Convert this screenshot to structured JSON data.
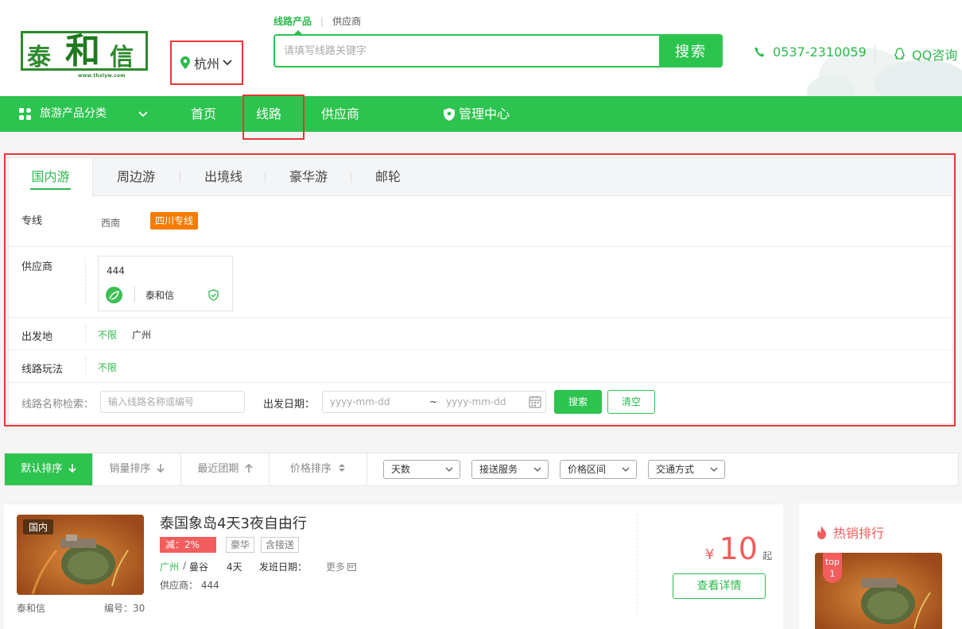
{
  "header": {
    "logo_text": "泰和信",
    "logo_url": "www.thxlyw.com",
    "city": "杭州",
    "search_tabs": [
      "线路产品",
      "供应商"
    ],
    "search_placeholder": "请填写线路关键字",
    "search_button": "搜索",
    "phone": "0537-2310059",
    "qq": "QQ咨询"
  },
  "nav": {
    "category": "旅游产品分类",
    "items": [
      "首页",
      "线路",
      "供应商",
      "管理中心"
    ]
  },
  "filter": {
    "tabs": [
      "国内游",
      "周边游",
      "出境线",
      "豪华游",
      "邮轮"
    ],
    "active_tab": "国内游",
    "line_label": "专线",
    "line_options": [
      "西南",
      "四川专线"
    ],
    "supplier_label": "供应商",
    "supplier_card": {
      "number": "444",
      "name": "泰和信"
    },
    "departure_label": "出发地",
    "departure_options": [
      "不限",
      "广州"
    ],
    "play_label": "线路玩法",
    "play_options": [
      "不限"
    ],
    "name_search_label": "线路名称检索：",
    "name_search_placeholder": "输入线路名称或编号",
    "date_label": "出发日期：",
    "date_placeholder": "yyyy-mm-dd",
    "date_sep": "~",
    "search_button": "搜索",
    "clear_button": "清空"
  },
  "sort": {
    "items": [
      "默认排序",
      "销量排序",
      "最近团期",
      "价格排序"
    ],
    "dropdowns": [
      "天数",
      "接送服务",
      "价格区间",
      "交通方式"
    ]
  },
  "product": {
    "thumb_tag": "国内",
    "title": "泰国象岛4天3夜自由行",
    "discount": "减：2%",
    "tags": [
      "豪华",
      "含接送"
    ],
    "from_city": "广州",
    "route_sep": "/",
    "to_city": "曼谷",
    "days": "4天",
    "departure_label": "发班日期：",
    "more": "更多",
    "supplier": "供应商： 444",
    "brand": "泰和信",
    "code": "编号：30",
    "currency": "¥",
    "price": "10",
    "price_suffix": "起",
    "detail_button": "查看详情"
  },
  "hot": {
    "title": "热销排行",
    "badge_top": "top",
    "badge_num": "1"
  }
}
